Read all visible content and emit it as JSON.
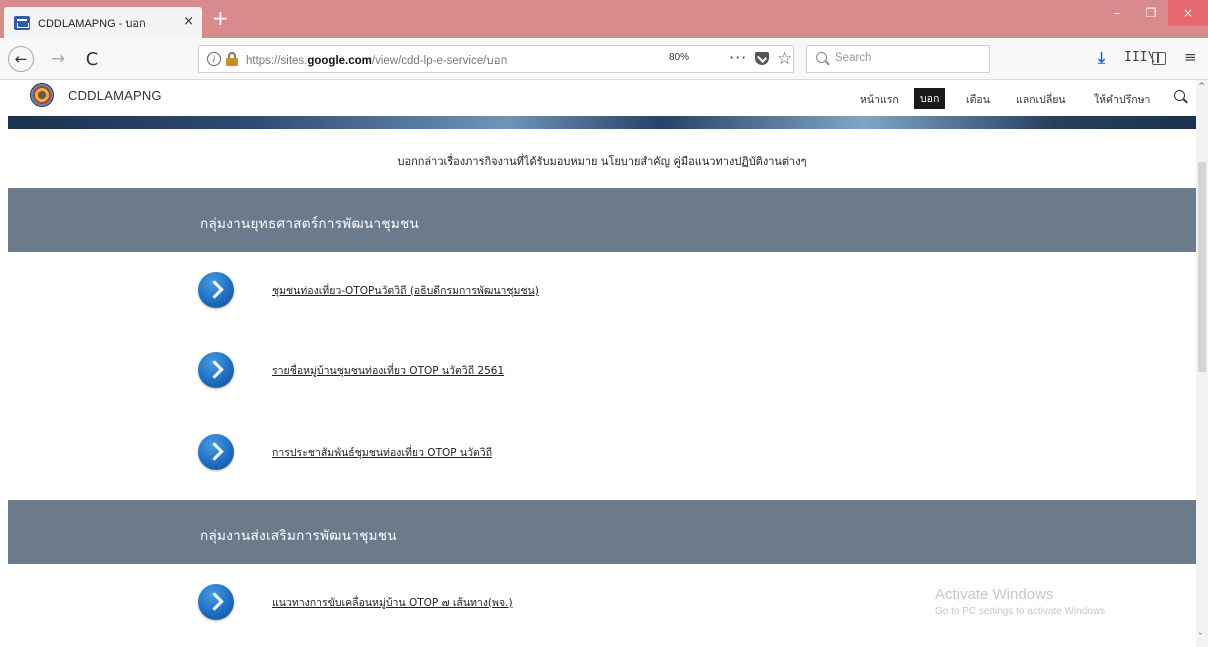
{
  "browser": {
    "tab_title": "CDDLAMAPNG - บอก",
    "tab_close": "×",
    "new_tab": "+",
    "url_prefix": "https://sites.",
    "url_domain": "google.com",
    "url_path": "/view/cdd-lp-e-service/บอก",
    "zoom": "80%",
    "search_placeholder": "Search",
    "icons": {
      "back": "←",
      "forward": "→",
      "reload": "C",
      "info": "i",
      "more": "···",
      "bookmark": "☆",
      "download": "⤓",
      "library": "III\\",
      "menu": "≡",
      "minimize": "–",
      "restore": "❐",
      "close": "×"
    }
  },
  "site": {
    "name": "CDDLAMAPNG",
    "nav": [
      "หน้าแรก",
      "บอก",
      "เตือน",
      "แลกเปลี่ยน",
      "ให้คำปรึกษา"
    ],
    "active_nav": "บอก"
  },
  "content": {
    "intro": "บอกกล่าวเรื่องภารกิจงานที่ได้รับมอบหมาย นโยบายสำคัญ คู่มือแนวทางปฏิบัติงานต่างๆ",
    "sections": [
      {
        "title": "กลุ่มงานยุทธศาสตร์การพัฒนาชุมชน",
        "links": [
          "ชุมชนท่องเที่ยว-OTOPนวัตวิถี (อธิบดีกรมการพัฒนาชุมชน)",
          "รายชื่อหมู่บ้านชุมชนท่องเที่ยว OTOP นวัตวิถี 2561",
          "การประชาสัมพันธ์ชุมชนท่องเที่ยว OTOP นวัตวิถี"
        ]
      },
      {
        "title": "กลุ่มงานส่งเสริมการพัฒนาชุมชน",
        "links": [
          "แนวทางการขับเคลื่อนหมู่บ้าน OTOP ๗ เส้นทาง(พจ.)"
        ]
      }
    ]
  },
  "watermark": {
    "title": "Activate Windows",
    "subtitle": "Go to PC settings to activate Windows"
  },
  "colors": {
    "tabbar": "#d98a8c",
    "section_band": "#6b7b8c",
    "arrow_blue": "#1f6ec2",
    "active_nav_bg": "#1a1a1a"
  }
}
